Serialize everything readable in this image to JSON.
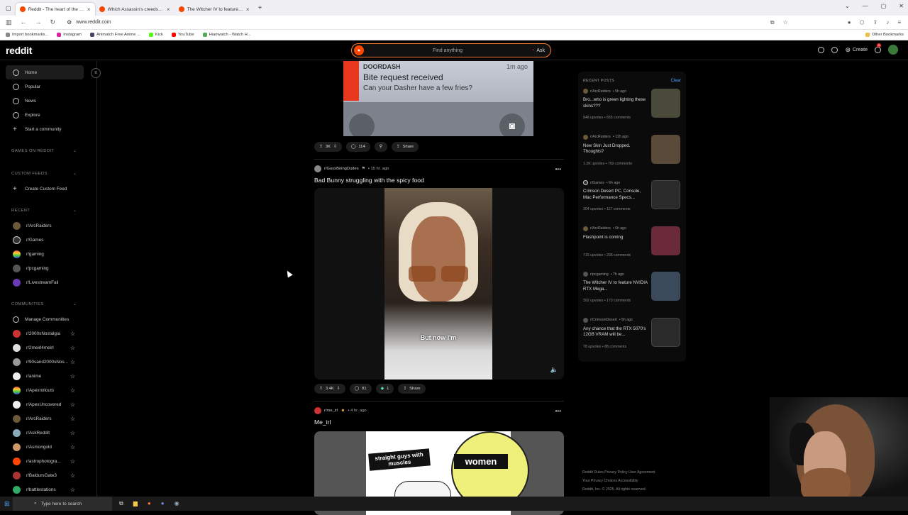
{
  "browser": {
    "tabs": [
      {
        "title": "Reddit - The heart of the internet",
        "active": true
      },
      {
        "title": "Which Assassin's creeds are wort",
        "active": false
      },
      {
        "title": "The Witcher IV to feature NVIDIA",
        "active": false
      }
    ],
    "url": "www.reddit.com",
    "bookmarks": [
      "Import bookmarks...",
      "Instagram",
      "Animatch Free Anime ...",
      "Kick",
      "YouTube",
      "Hianwatch - Watch H..."
    ],
    "other_bookmarks": "Other Bookmarks"
  },
  "header": {
    "logo": "reddit",
    "search_placeholder": "Find anything",
    "ask_label": "Ask",
    "create_label": "Create",
    "notification_count": "1"
  },
  "sidebar": {
    "nav": [
      {
        "label": "Home",
        "icon": "home-icon"
      },
      {
        "label": "Popular",
        "icon": "popular-icon"
      },
      {
        "label": "News",
        "icon": "news-icon"
      },
      {
        "label": "Explore",
        "icon": "explore-icon"
      },
      {
        "label": "Start a community",
        "icon": "plus-icon"
      }
    ],
    "games_header": "GAMES ON REDDIT",
    "custom_feeds_header": "CUSTOM FEEDS",
    "create_custom_feed": "Create Custom Feed",
    "recent_header": "RECENT",
    "recent": [
      "r/ArcRaiders",
      "r/Games",
      "r/gaming",
      "r/pcgaming",
      "r/LivestreamFail"
    ],
    "communities_header": "COMMUNITIES",
    "manage_communities": "Manage Communities",
    "communities": [
      "r/2000sNostalgia",
      "r/2meirl4meirl",
      "r/90sand2000sNos...",
      "r/anime",
      "r/Apexrollouts",
      "r/ApexUncovered",
      "r/ArcRaiders",
      "r/AskReddit",
      "r/Asmongold",
      "r/astrophotogra...",
      "r/BaldursGate3",
      "r/battlestations"
    ]
  },
  "feed": {
    "post1": {
      "notif_app": "DOORDASH",
      "notif_time": "1m ago",
      "notif_title": "Bite request received",
      "notif_body": "Can your Dasher have a few fries?",
      "votes": "3K",
      "comments": "114",
      "share": "Share"
    },
    "post2": {
      "subreddit": "r/GuysBeingDudes",
      "time": "• 15 hr. ago",
      "title": "Bad Bunny struggling with the spicy food",
      "caption": "But now I'm",
      "votes": "3.4K",
      "comments": "81",
      "awards": "1",
      "share": "Share"
    },
    "post3": {
      "subreddit": "r/me_irl",
      "time": "• 4 hr. ago",
      "title": "Me_irl",
      "meme_left": "straight guys with muscles",
      "meme_right": "women"
    }
  },
  "recent_posts": {
    "header": "RECENT POSTS",
    "clear": "Clear",
    "items": [
      {
        "sub": "r/ArcRaiders",
        "time": "• 5h ago",
        "title": "Bro...who is green lighting these skins???",
        "stats": "848 upvotes • 665 comments",
        "thumb_color": "#4a4a3a"
      },
      {
        "sub": "r/ArcRaiders",
        "time": "• 12h ago",
        "title": "New Skin Just Dropped. Thoughts?",
        "stats": "1.2K upvotes • 792 comments",
        "thumb_color": "#5a4a3a"
      },
      {
        "sub": "r/Games",
        "time": "• 6h ago",
        "title": "Crimson Desert PC, Console, Mac Performance Specs...",
        "stats": "304 upvotes • 117 comments",
        "thumb_color": "#2a2a2a"
      },
      {
        "sub": "r/ArcRaiders",
        "time": "• 6h ago",
        "title": "Flashpoint is coming",
        "stats": "715 upvotes • 296 comments",
        "thumb_color": "#6a2a3a"
      },
      {
        "sub": "r/pcgaming",
        "time": "• 7h ago",
        "title": "The Witcher IV to feature NVIDIA RTX Mega...",
        "stats": "392 upvotes • 173 comments",
        "thumb_color": "#3a4a5a"
      },
      {
        "sub": "r/CrimsonDesert",
        "time": "• 5h ago",
        "title": "Any chance that the RTX 5070's 12GB VRAM will be...",
        "stats": "78 upvotes • 88 comments",
        "thumb_color": "#2a2a2a"
      }
    ]
  },
  "footer": {
    "line1": "Reddit Rules   Privacy Policy   User Agreement",
    "line2": "Your Privacy Choices   Accessibility",
    "line3": "Reddit, Inc. © 2025. All rights reserved."
  },
  "taskbar": {
    "search_placeholder": "Type here to search"
  }
}
